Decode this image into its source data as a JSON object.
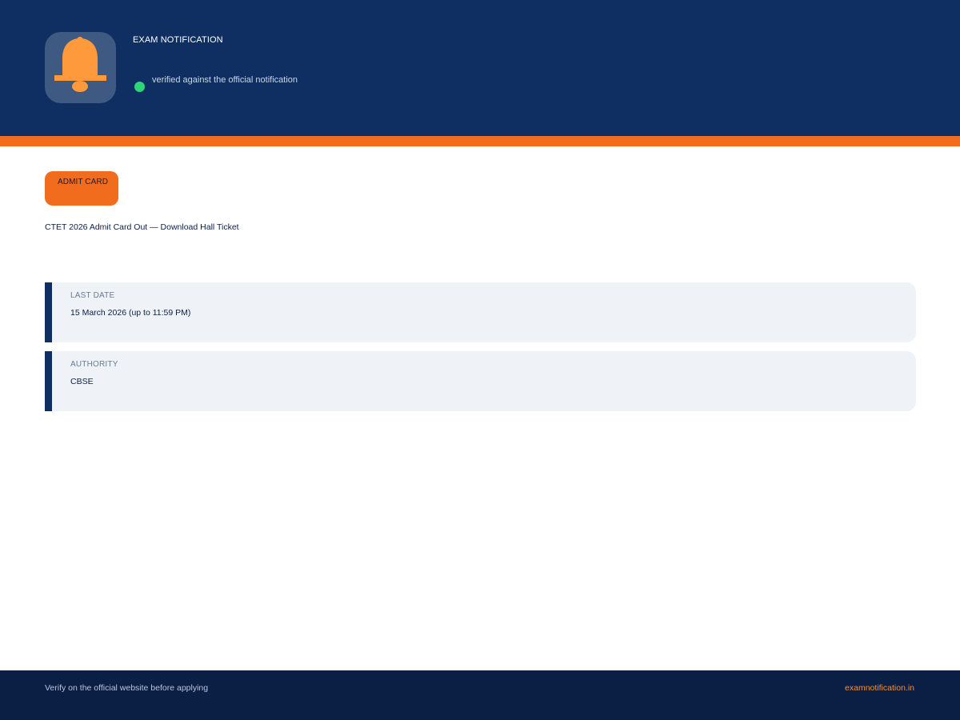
{
  "header": {
    "eyebrow": "EXAM NOTIFICATION",
    "verified_text": "verified against the official notification",
    "icon": "bell-icon"
  },
  "badge": {
    "label": "ADMIT CARD"
  },
  "headline": "CTET 2026 Admit Card Out — Download Hall Ticket",
  "details": [
    {
      "label": "LAST DATE",
      "value": "15 March 2026 (up to 11:59 PM)"
    },
    {
      "label": "AUTHORITY",
      "value": "CBSE"
    }
  ],
  "footer": {
    "note": "Verify on the official website before applying",
    "site": "examnotification.in"
  },
  "colors": {
    "navy": "#0f2f62",
    "accent_orange": "#f26c1d",
    "bell_orange": "#ff9a3c",
    "verified_green": "#2ed67a"
  }
}
